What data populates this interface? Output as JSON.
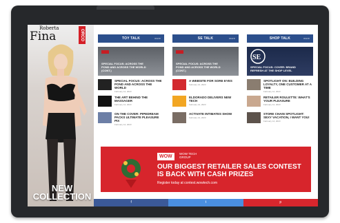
{
  "ad": {
    "brand_small": "Roberta",
    "brand_name": "Fina",
    "logo_text": "ORCO",
    "collection_text": "NEW COLLECTION"
  },
  "columns": [
    {
      "title": "TOY TALK",
      "more": "more",
      "feature_title": "SPECIAL FOCUS: ACROSS THE POND AND ACROSS THE WORLD (CONT.)",
      "items": [
        {
          "title": "SPECIAL FOCUS: ACROSS THE POND AND ACROSS THE WORLD",
          "meta": "February 14, 2023"
        },
        {
          "title": "THE ART BEHIND THE MASSAGER",
          "meta": "February 14, 2023"
        },
        {
          "title": "ON THE COVER: PIPEDREAM PACKS ULTIMATE PLEASURE PIX",
          "meta": "February 14, 2023"
        }
      ]
    },
    {
      "title": "SE TALK",
      "more": "more",
      "feature_title": "SPECIAL FOCUS: ACROSS THE POND AND ACROSS THE WORLD (CONT.)",
      "items": [
        {
          "title": "A WEBSITE FOR SORE EYES",
          "meta": "February 14, 2023"
        },
        {
          "title": "ELDORADO DELIVERS NEW TECH",
          "meta": "February 14, 2023"
        },
        {
          "title": "ACTIVATE INTIMATES SHOW",
          "meta": "February 14, 2023"
        }
      ]
    },
    {
      "title": "SHOP TALK",
      "more": "more",
      "feature_title": "SPECIAL FOCUS: COVER: BRAND REFRESH AT THE SHOP LEVEL",
      "items": [
        {
          "title": "SPOTLIGHT ON: BUILDING LOYALTY, ONE CUSTOMER AT A TIME",
          "meta": "February 14, 2023"
        },
        {
          "title": "RETAILER ROULETTE: WHAT'S YOUR PLEASURE",
          "meta": "February 14, 2023"
        },
        {
          "title": "STORE CHAIN SPOTLIGHT: SEXY VACATION, I WANT YOU!",
          "meta": "February 14, 2023"
        }
      ]
    }
  ],
  "banner": {
    "badge": "WOW",
    "badge_sub": "WOW TECH GROUP",
    "headline": "OUR BIGGEST RETAILER SALES CONTEST IS BACK WITH CASH PRIZES",
    "register": "Register today at contest.wowtech.com"
  },
  "social": {
    "facebook": "f",
    "twitter": "t",
    "pinterest": "p"
  }
}
